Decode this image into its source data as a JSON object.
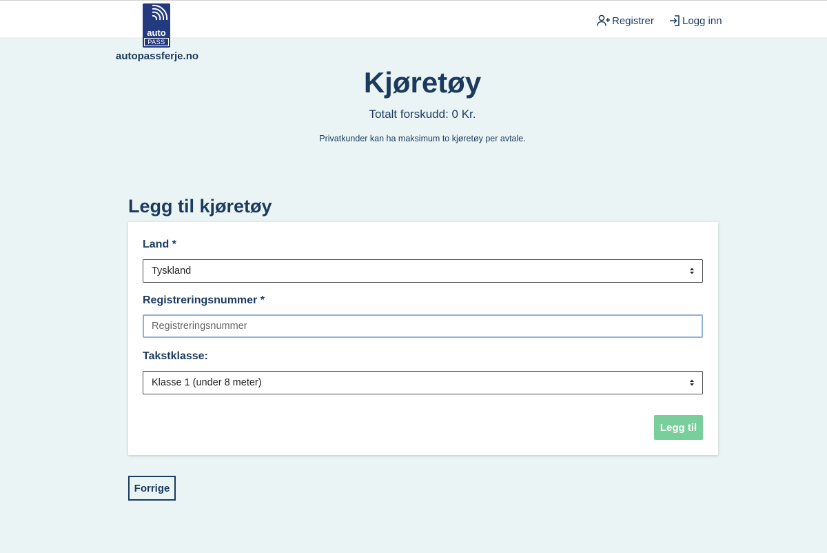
{
  "header": {
    "logo": {
      "word_auto": "auto",
      "word_pass": "PASS",
      "domain": "autopassferje.no",
      "brand_color": "#233a80"
    },
    "nav": {
      "register_label": "Registrer",
      "login_label": "Logg inn",
      "register_icon": "user-plus-icon",
      "login_icon": "login-icon"
    }
  },
  "page": {
    "title": "Kjøretøy",
    "total_advance": "Totalt forskudd: 0 Kr.",
    "note": "Privatkunder kan ha maksimum to kjøretøy per avtale."
  },
  "form": {
    "section_title": "Legg til kjøretøy",
    "country": {
      "label": "Land *",
      "value": "Tyskland"
    },
    "registration": {
      "label": "Registreringsnummer *",
      "placeholder": "Registreringsnummer",
      "value": ""
    },
    "rate_class": {
      "label": "Takstklasse:",
      "value": "Klasse 1 (under 8 meter)"
    },
    "submit_label": "Legg til"
  },
  "footer_nav": {
    "previous_label": "Forrige"
  },
  "colors": {
    "background": "#eaf4f4",
    "text": "#1b3a5e",
    "add_button": "#78cf9b",
    "input_focus_border": "#8fb1d6"
  }
}
